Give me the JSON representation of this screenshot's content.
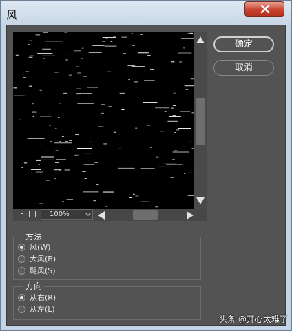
{
  "window": {
    "title": "风"
  },
  "preview": {
    "zoom_value": "100%"
  },
  "buttons": {
    "ok_label": "确定",
    "cancel_label": "取消"
  },
  "method_group": {
    "legend": "方法",
    "options": [
      {
        "label": "风(W)",
        "selected": true
      },
      {
        "label": "大风(B)",
        "selected": false
      },
      {
        "label": "飓风(S)",
        "selected": false
      }
    ]
  },
  "direction_group": {
    "legend": "方向",
    "options": [
      {
        "label": "从右(R)",
        "selected": true
      },
      {
        "label": "从左(L)",
        "selected": false
      }
    ]
  },
  "watermark": "头条 @开心太难了",
  "colors": {
    "panel": "#535353",
    "preview_bg": "#000000",
    "close_red": "#c9442f"
  }
}
